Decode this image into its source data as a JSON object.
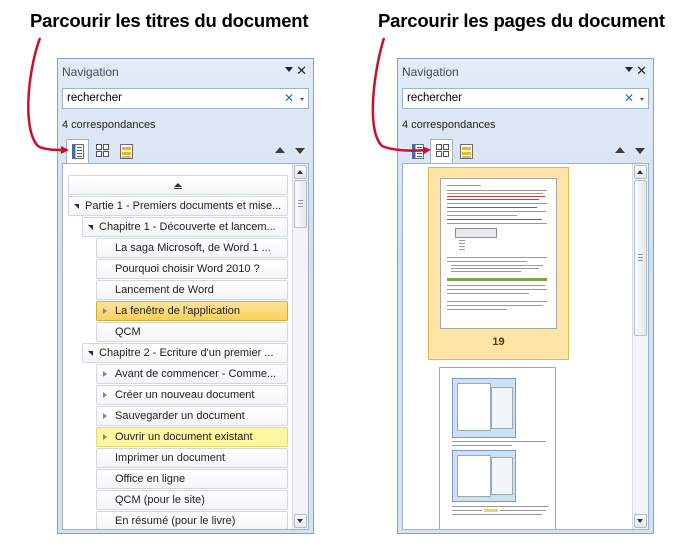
{
  "captions": {
    "left": "Parcourir les titres du document",
    "right": "Parcourir les pages du document"
  },
  "pane": {
    "title": "Navigation",
    "close_label": "✕",
    "search_value": "rechercher",
    "clear_label": "✕",
    "matches_text": "4 correspondances"
  },
  "headings": [
    {
      "label": "Partie 1 - Premiers documents et mise...",
      "level": 1,
      "state": "normal"
    },
    {
      "label": "Chapitre 1 - Découverte et lancem...",
      "level": 2,
      "state": "normal"
    },
    {
      "label": "La saga Microsoft, de Word 1 ...",
      "level": 3,
      "state": "normal"
    },
    {
      "label": "Pourquoi choisir Word 2010 ?",
      "level": 3,
      "state": "normal"
    },
    {
      "label": "Lancement de Word",
      "level": 3,
      "state": "normal"
    },
    {
      "label": "La fenêtre de l'application",
      "level": 3,
      "state": "selected"
    },
    {
      "label": "QCM",
      "level": 3,
      "state": "normal"
    },
    {
      "label": "Chapitre 2 - Ecriture d'un premier ...",
      "level": 2,
      "state": "normal"
    },
    {
      "label": "Avant de commencer - Comme...",
      "level": 3,
      "state": "normal"
    },
    {
      "label": "Créer un nouveau document",
      "level": 3,
      "state": "normal"
    },
    {
      "label": "Sauvegarder un document",
      "level": 3,
      "state": "normal"
    },
    {
      "label": "Ouvrir un document existant",
      "level": 3,
      "state": "highlight"
    },
    {
      "label": "Imprimer un document",
      "level": 3,
      "state": "normal"
    },
    {
      "label": "Office en ligne",
      "level": 3,
      "state": "normal"
    },
    {
      "label": "QCM (pour le site)",
      "level": 3,
      "state": "normal"
    },
    {
      "label": "En résumé (pour le livre)",
      "level": 3,
      "state": "normal"
    }
  ],
  "pages": {
    "selected_page_number": "19"
  },
  "colors": {
    "annotation_arrow": "#c8102e",
    "selected_fill": "#fbd15d",
    "highlight_fill": "#fff6a4",
    "pane_background": "#d6e1f0"
  }
}
